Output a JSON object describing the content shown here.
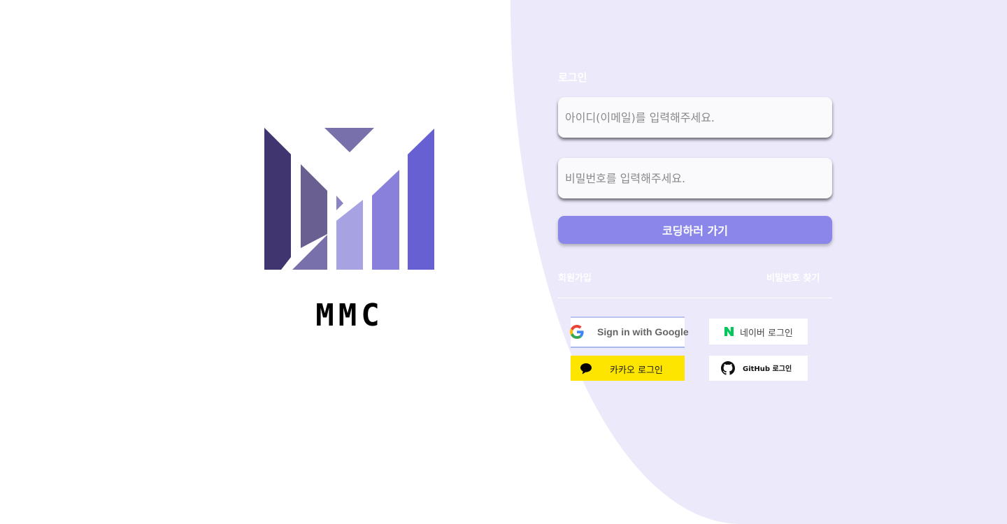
{
  "brand": {
    "name": "MMC",
    "logo_icon": "mmc-logo-icon"
  },
  "login": {
    "title": "로그인",
    "id_placeholder": "아이디(이메일)를 입력해주세요.",
    "password_placeholder": "비밀번호를 입력해주세요.",
    "submit_label": "코딩하러 가기",
    "signup_label": "회원가입",
    "find_password_label": "비밀번호 찾기"
  },
  "social": {
    "google": {
      "label": "Sign in with Google",
      "icon": "google-icon"
    },
    "naver": {
      "label": "네이버 로그인",
      "icon": "naver-icon",
      "color": "#03c75a"
    },
    "kakao": {
      "label": "카카오 로그인",
      "icon": "kakao-icon",
      "color": "#fee500"
    },
    "github": {
      "label": "GitHub 로그인",
      "icon": "github-icon"
    }
  },
  "colors": {
    "panel_bg": "#ebe9fa",
    "accent": "#8a86ea",
    "logo_dark": "#40356e",
    "logo_mid": "#695f90",
    "logo_light": "#a7a2e2",
    "logo_blue": "#6660d2"
  }
}
